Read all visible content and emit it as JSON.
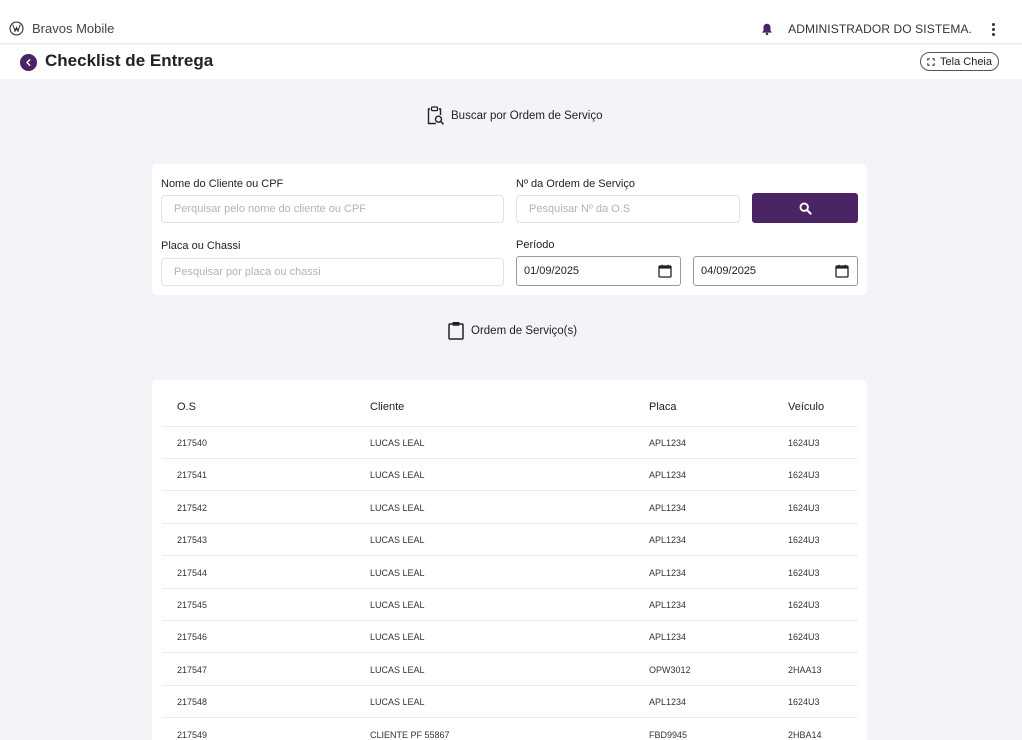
{
  "header": {
    "app_name": "Bravos Mobile",
    "user_name": "ADMINISTRADOR DO SISTEMA.",
    "logo_icon": "vw-logo-icon",
    "bell_icon": "bell-icon",
    "menu_icon": "more-vert-icon"
  },
  "titlebar": {
    "title": "Checklist de Entrega",
    "fullscreen_label": "Tela Cheia"
  },
  "search_section": {
    "heading": "Buscar por Ordem de Serviço",
    "client_label": "Nome do Cliente ou CPF",
    "client_placeholder": "Perquisar pelo nome do cliente ou CPF",
    "client_value": "",
    "os_label": "Nº da Ordem de Serviço",
    "os_placeholder": "Pesquisar Nº da O.S",
    "os_value": "",
    "plate_label": "Placa ou Chassi",
    "plate_placeholder": "Pesquisar por placa ou chassi",
    "plate_value": "",
    "period_label": "Período",
    "date_start": "01/09/2025",
    "date_end": "04/09/2025"
  },
  "os_section": {
    "heading": "Ordem de Serviço(s)"
  },
  "table": {
    "columns": [
      "O.S",
      "Cliente",
      "Placa",
      "Veículo"
    ],
    "rows": [
      [
        "217540",
        "LUCAS LEAL",
        "APL1234",
        "1624U3"
      ],
      [
        "217541",
        "LUCAS LEAL",
        "APL1234",
        "1624U3"
      ],
      [
        "217542",
        "LUCAS LEAL",
        "APL1234",
        "1624U3"
      ],
      [
        "217543",
        "LUCAS LEAL",
        "APL1234",
        "1624U3"
      ],
      [
        "217544",
        "LUCAS LEAL",
        "APL1234",
        "1624U3"
      ],
      [
        "217545",
        "LUCAS LEAL",
        "APL1234",
        "1624U3"
      ],
      [
        "217546",
        "LUCAS LEAL",
        "APL1234",
        "1624U3"
      ],
      [
        "217547",
        "LUCAS LEAL",
        "OPW3012",
        "2HAA13"
      ],
      [
        "217548",
        "LUCAS LEAL",
        "APL1234",
        "1624U3"
      ],
      [
        "217549",
        "CLIENTE PF 55867",
        "FBD9945",
        "2HBA14"
      ]
    ]
  },
  "colors": {
    "brand": "#4a2464",
    "background": "#f4f4f8",
    "card": "#ffffff"
  }
}
